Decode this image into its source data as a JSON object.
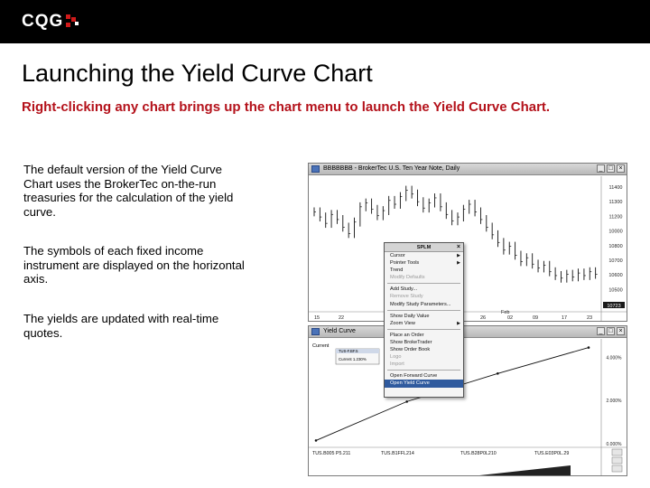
{
  "header": {
    "logo_text": "CQG",
    "brand_color": "#000000",
    "accent_color": "#d01a1a"
  },
  "slide": {
    "title": "Launching the Yield Curve Chart",
    "subtitle": "Right-clicking any chart brings up the chart menu to launch the Yield Curve Chart.",
    "subtitle_color": "#b4121b",
    "paragraphs": [
      "The default version of the Yield Curve Chart uses the BrokerTec on-the-run treasuries for the calculation of the yield curve.",
      "The symbols of each fixed income instrument are displayed on the horizontal axis.",
      "The yields are updated with real-time quotes."
    ]
  },
  "price_chart": {
    "window_title": "BBBBBBB - BrokerTec U.S. Ten Year Note, Daily",
    "y_ticks": [
      "11400",
      "11300",
      "11200",
      "10000",
      "10800",
      "10700",
      "10600",
      "10500"
    ],
    "x_ticks": [
      "15",
      "22",
      "26",
      "02",
      "09",
      "17",
      "23"
    ],
    "month_label": "Feb",
    "last_price": "10723",
    "closes": [
      112.2,
      111.8,
      111.3,
      112.0,
      111.6,
      111.0,
      110.5,
      111.4,
      112.6,
      112.9,
      112.4,
      111.9,
      112.3,
      113.1,
      112.8,
      113.4,
      113.9,
      113.6,
      113.0,
      112.5,
      112.9,
      113.3,
      112.6,
      112.0,
      111.5,
      111.8,
      112.4,
      112.8,
      112.2,
      111.6,
      111.0,
      110.4,
      109.8,
      109.2,
      109.5,
      108.8,
      108.3,
      108.6,
      108.1,
      107.8,
      108.0,
      107.5,
      107.2,
      107.0,
      107.3,
      107.1,
      107.4,
      107.2,
      107.5,
      107.3
    ]
  },
  "context_menu": {
    "header": "SPLM",
    "items": [
      {
        "label": "Cursor",
        "has_submenu": true,
        "state": "normal"
      },
      {
        "label": "Pointer Tools",
        "has_submenu": true,
        "state": "normal"
      },
      {
        "label": "Trend",
        "has_submenu": false,
        "state": "normal"
      },
      {
        "label": "Modify Defaults",
        "has_submenu": false,
        "state": "dim"
      },
      {
        "sep": true
      },
      {
        "label": "Add Study...",
        "has_submenu": false,
        "state": "normal"
      },
      {
        "label": "Remove Study",
        "has_submenu": false,
        "state": "dim"
      },
      {
        "label": "Modify Study Parameters...",
        "has_submenu": false,
        "state": "normal"
      },
      {
        "sep": true
      },
      {
        "label": "Show Daily Value",
        "has_submenu": false,
        "state": "normal"
      },
      {
        "label": "Zoom View",
        "has_submenu": true,
        "state": "normal"
      },
      {
        "sep": true
      },
      {
        "label": "Place an Order",
        "has_submenu": false,
        "state": "normal"
      },
      {
        "label": "Show BrokeTrader",
        "has_submenu": false,
        "state": "normal"
      },
      {
        "label": "Show Order Book",
        "has_submenu": false,
        "state": "normal"
      },
      {
        "label": "Logo",
        "has_submenu": false,
        "state": "dim"
      },
      {
        "label": "Import",
        "has_submenu": false,
        "state": "dim"
      },
      {
        "sep": true
      },
      {
        "label": "Open Forward Curve",
        "has_submenu": false,
        "state": "normal"
      },
      {
        "label": "Open Yield Curve",
        "has_submenu": false,
        "state": "highlight"
      }
    ]
  },
  "yield_chart": {
    "window_title": "Yield Curve",
    "legend_label": "Current",
    "legend_box_title": "TUS-F.BF.5",
    "legend_box_value": "Current    1.230%",
    "y_ticks": [
      "4.000%",
      "2.000%",
      "0.000%"
    ],
    "x_labels": [
      "TUS.B005 P5.211",
      "TUS.B1FFL214",
      "TUS.B28P0L210",
      "TUS.E03P0L.29"
    ],
    "points": [
      {
        "x": 0,
        "y": 0.15
      },
      {
        "x": 1,
        "y": 1.95
      },
      {
        "x": 2,
        "y": 3.25
      },
      {
        "x": 3,
        "y": 4.45
      }
    ],
    "y_range": [
      0,
      4.6
    ]
  }
}
